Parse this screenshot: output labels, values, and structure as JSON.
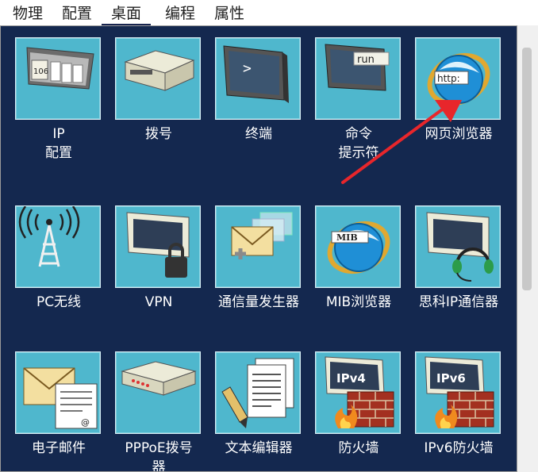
{
  "tabs": [
    {
      "label": "物理"
    },
    {
      "label": "配置"
    },
    {
      "label": "桌面",
      "active": true
    },
    {
      "label": "编程"
    },
    {
      "label": "属性"
    }
  ],
  "apps": [
    {
      "label_line1": "IP",
      "label_line2": "配置",
      "icon": "ip-config-icon",
      "tile_text": "106"
    },
    {
      "label_line1": "拨号",
      "label_line2": "",
      "icon": "dialup-modem-icon"
    },
    {
      "label_line1": "终端",
      "label_line2": "",
      "icon": "terminal-icon",
      "tile_text": ">"
    },
    {
      "label_line1": "命令",
      "label_line2": "提示符",
      "icon": "command-prompt-icon",
      "tile_text": "run"
    },
    {
      "label_line1": "网页浏览器",
      "label_line2": "",
      "icon": "web-browser-icon",
      "tile_text": "http:"
    },
    {
      "label_line1": "PC无线",
      "label_line2": "",
      "icon": "wireless-antenna-icon"
    },
    {
      "label_line1": "VPN",
      "label_line2": "",
      "icon": "vpn-lock-icon"
    },
    {
      "label_line1": "通信量发生器",
      "label_line2": "",
      "icon": "traffic-generator-icon"
    },
    {
      "label_line1": "MIB浏览器",
      "label_line2": "",
      "icon": "mib-browser-icon",
      "tile_text": "MIB"
    },
    {
      "label_line1": "思科IP通信器",
      "label_line2": "",
      "icon": "ip-communicator-icon"
    },
    {
      "label_line1": "电子邮件",
      "label_line2": "",
      "icon": "email-icon"
    },
    {
      "label_line1": "PPPoE拨号",
      "label_line2": "器",
      "icon": "pppoe-dialer-icon"
    },
    {
      "label_line1": "文本编辑器",
      "label_line2": "",
      "icon": "text-editor-icon"
    },
    {
      "label_line1": "防火墙",
      "label_line2": "",
      "icon": "firewall-icon",
      "tile_text": "IPv4"
    },
    {
      "label_line1": "IPv6防火墙",
      "label_line2": "",
      "icon": "ipv6-firewall-icon",
      "tile_text": "IPv6"
    }
  ],
  "colors": {
    "desktop_bg": "#14284f",
    "tile_bg": "#4fb7cd",
    "annotation_arrow": "#e8262b"
  }
}
